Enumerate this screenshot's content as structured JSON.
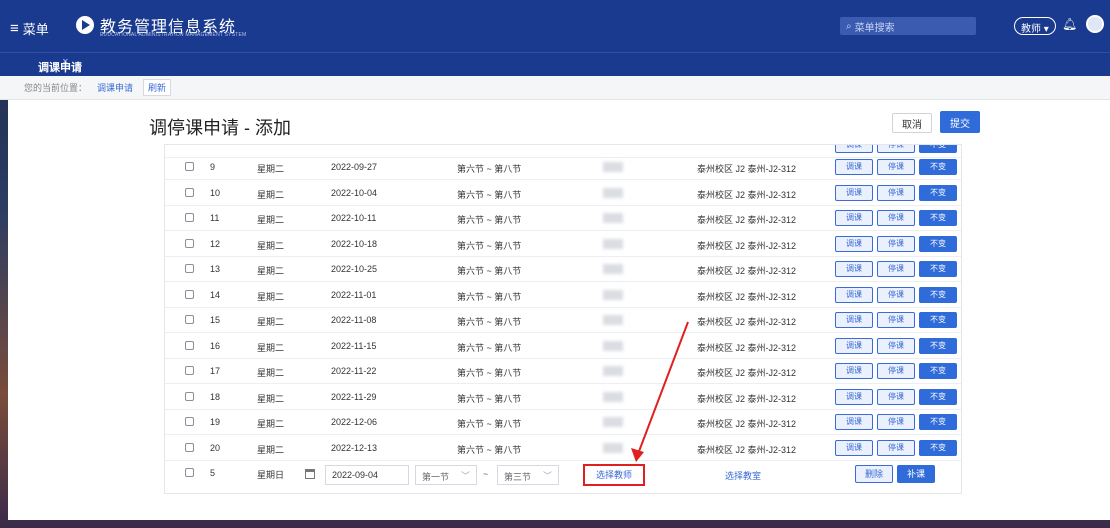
{
  "header": {
    "menu_label": "菜单",
    "app_title": "教务管理信息系统",
    "app_subtitle": "EDUCATIONAL ADMINISTRATION MANAGEMENT SYSTEM",
    "search_placeholder": "菜单搜索",
    "role_label": "教师 ▾"
  },
  "tabbar": {
    "active_tab": "调课申请"
  },
  "breadcrumb": {
    "prefix": "您的当前位置：",
    "current": "调课申请",
    "refresh": "刷新"
  },
  "page": {
    "title": "调停课申请 - 添加",
    "cancel": "取消",
    "submit": "提交"
  },
  "actions": {
    "tk": "调课",
    "stop": "停课",
    "keep": "不变"
  },
  "rows": [
    {
      "no": "9",
      "weekday": "星期二",
      "date": "2022-09-27",
      "period": "第六节 ~ 第八节",
      "room": "泰州校区 J2 泰州-J2-312"
    },
    {
      "no": "10",
      "weekday": "星期二",
      "date": "2022-10-04",
      "period": "第六节 ~ 第八节",
      "room": "泰州校区 J2 泰州-J2-312"
    },
    {
      "no": "11",
      "weekday": "星期二",
      "date": "2022-10-11",
      "period": "第六节 ~ 第八节",
      "room": "泰州校区 J2 泰州-J2-312"
    },
    {
      "no": "12",
      "weekday": "星期二",
      "date": "2022-10-18",
      "period": "第六节 ~ 第八节",
      "room": "泰州校区 J2 泰州-J2-312"
    },
    {
      "no": "13",
      "weekday": "星期二",
      "date": "2022-10-25",
      "period": "第六节 ~ 第八节",
      "room": "泰州校区 J2 泰州-J2-312"
    },
    {
      "no": "14",
      "weekday": "星期二",
      "date": "2022-11-01",
      "period": "第六节 ~ 第八节",
      "room": "泰州校区 J2 泰州-J2-312"
    },
    {
      "no": "15",
      "weekday": "星期二",
      "date": "2022-11-08",
      "period": "第六节 ~ 第八节",
      "room": "泰州校区 J2 泰州-J2-312"
    },
    {
      "no": "16",
      "weekday": "星期二",
      "date": "2022-11-15",
      "period": "第六节 ~ 第八节",
      "room": "泰州校区 J2 泰州-J2-312"
    },
    {
      "no": "17",
      "weekday": "星期二",
      "date": "2022-11-22",
      "period": "第六节 ~ 第八节",
      "room": "泰州校区 J2 泰州-J2-312"
    },
    {
      "no": "18",
      "weekday": "星期二",
      "date": "2022-11-29",
      "period": "第六节 ~ 第八节",
      "room": "泰州校区 J2 泰州-J2-312"
    },
    {
      "no": "19",
      "weekday": "星期二",
      "date": "2022-12-06",
      "period": "第六节 ~ 第八节",
      "room": "泰州校区 J2 泰州-J2-312"
    },
    {
      "no": "20",
      "weekday": "星期二",
      "date": "2022-12-13",
      "period": "第六节 ~ 第八节",
      "room": "泰州校区 J2 泰州-J2-312"
    }
  ],
  "new_row": {
    "no": "5",
    "weekday": "星期日",
    "date": "2022-09-04",
    "start_period": "第一节",
    "end_period": "第三节",
    "tilde": "~",
    "pick_teacher": "选择教师",
    "pick_room": "选择教室",
    "delete": "删除",
    "add": "补课"
  },
  "colors": {
    "topbar": "#1a3a8f",
    "primary": "#2f6bd9",
    "highlight": "#e02020"
  }
}
